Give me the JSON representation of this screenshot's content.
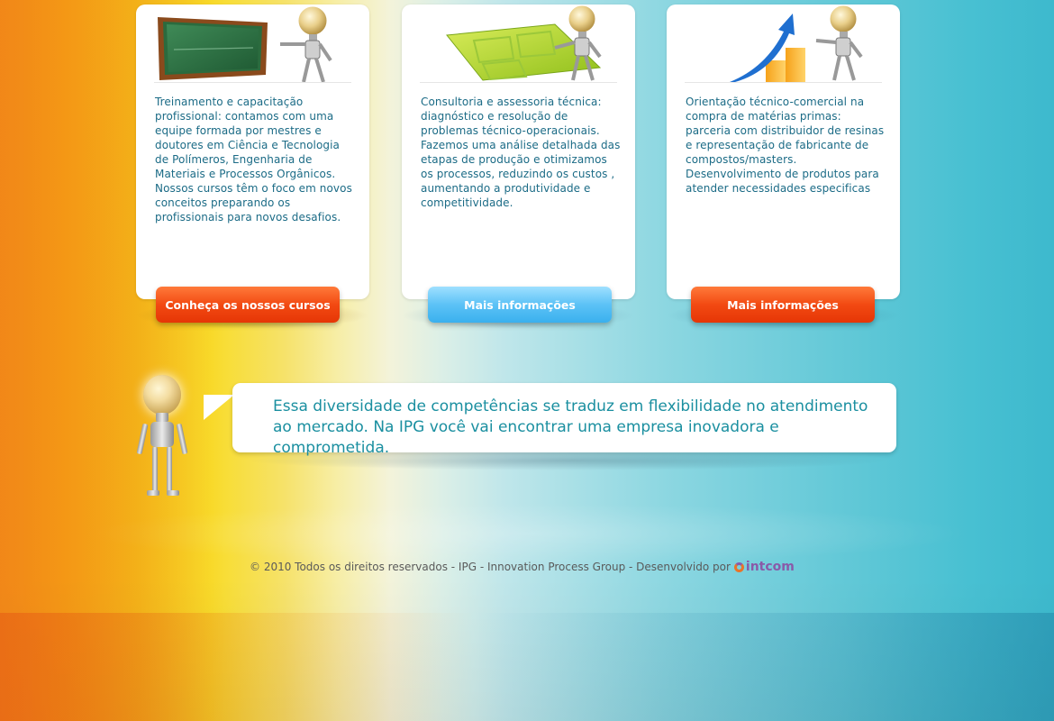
{
  "cards": [
    {
      "text": "Treinamento e capacitação profissional: contamos com uma equipe formada por mestres e doutores em Ciência e Tecnologia de Polímeros, Engenharia de Materiais e Processos Orgânicos. Nossos cursos têm o foco em novos conceitos preparando os profissionais para novos desafios.",
      "button_label": "Conheça os nossos cursos",
      "button_color": "#f24a12",
      "art": "chalkboard-illustration"
    },
    {
      "text": "Consultoria e assessoria técnica: diagnóstico e resolução de problemas técnico-operacionais. Fazemos uma análise detalhada das etapas de produção e otimizamos os processos, reduzindo os custos , aumentando a produtividade e competitividade.",
      "button_label": "Mais informações",
      "button_color": "#5cc2f6",
      "art": "puzzle-illustration"
    },
    {
      "text": "Orientação técnico-comercial na compra de matérias primas: parceria com distribuidor de resinas e representação de fabricante de compostos/masters. Desenvolvimento de produtos para atender necessidades especificas",
      "button_label": "Mais informações",
      "button_color": "#f24a12",
      "art": "growth-chart-illustration"
    }
  ],
  "speech": {
    "line1": "Essa diversidade de competências se traduz em flexibilidade no atendimento",
    "line2": "ao mercado. Na IPG você vai encontrar uma empresa inovadora e comprometida."
  },
  "footer": {
    "text": "© 2010 Todos os direitos reservados - IPG - Innovation Process Group - Desenvolvido por",
    "brand": "intcom"
  },
  "colors": {
    "text_teal": "#1b6b86",
    "speech_teal": "#1a8fa0",
    "orange_button": "#f24a12",
    "blue_button": "#5cc2f6",
    "brand_purple": "#8a5aa8"
  }
}
